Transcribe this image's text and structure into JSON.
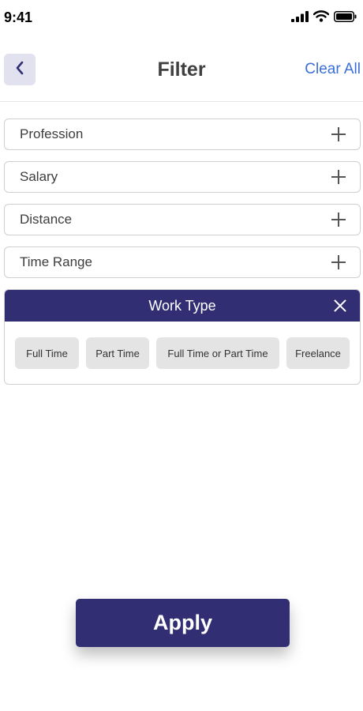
{
  "status_bar": {
    "time": "9:41",
    "icons": [
      "signal-icon",
      "wifi-icon",
      "battery-icon"
    ]
  },
  "header": {
    "back_icon": "chevron-left-icon",
    "title": "Filter",
    "clear_all": "Clear All"
  },
  "filters": [
    {
      "label": "Profession",
      "icon": "plus-icon"
    },
    {
      "label": "Salary",
      "icon": "plus-icon"
    },
    {
      "label": "Distance",
      "icon": "plus-icon"
    },
    {
      "label": "Time Range",
      "icon": "plus-icon"
    }
  ],
  "work_type": {
    "title": "Work Type",
    "close_icon": "close-icon",
    "options": [
      "Full Time",
      "Part Time",
      "Full Time or Part Time",
      "Freelance"
    ]
  },
  "apply_label": "Apply",
  "colors": {
    "primary": "#322e73",
    "link": "#3a6fd8",
    "back_button_bg": "#e2e1ef",
    "chip_bg": "#e4e4e4",
    "border": "#cfcfcf"
  }
}
